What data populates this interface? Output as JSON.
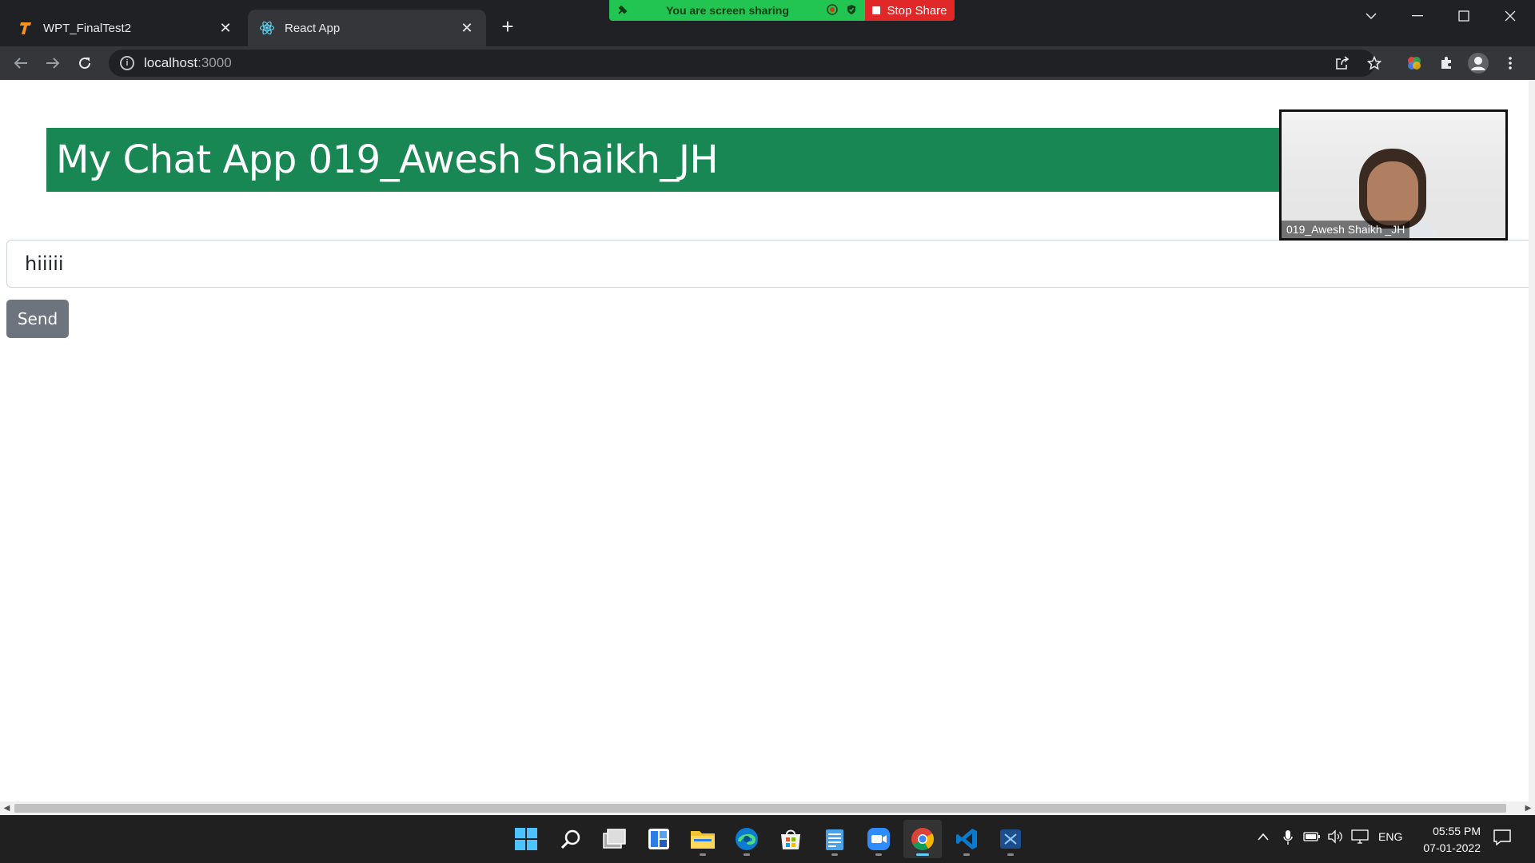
{
  "browser": {
    "tabs": [
      {
        "title": "WPT_FinalTest2",
        "active": false
      },
      {
        "title": "React App",
        "active": true
      }
    ],
    "address": {
      "host": "localhost",
      "port": ":3000"
    }
  },
  "zoom": {
    "sharing_text": "You are screen sharing",
    "stop_label": "Stop Share",
    "video_label": "019_Awesh Shaikh _JH"
  },
  "app": {
    "header": "My Chat App 019_Awesh Shaikh_JH",
    "message_value": "hiiiii",
    "send_label": "Send"
  },
  "taskbar": {
    "apps": [
      "windows-start",
      "search",
      "task-view",
      "widgets",
      "file-explorer",
      "edge",
      "microsoft-store",
      "notepad",
      "zoom",
      "chrome",
      "vscode",
      "snipping-tool"
    ],
    "language": "ENG",
    "time": "05:55 PM",
    "date": "07-01-2022"
  },
  "colors": {
    "header_green": "#198754",
    "send_gray": "#6c757d",
    "share_green": "#23c552",
    "stop_red": "#e02828"
  }
}
